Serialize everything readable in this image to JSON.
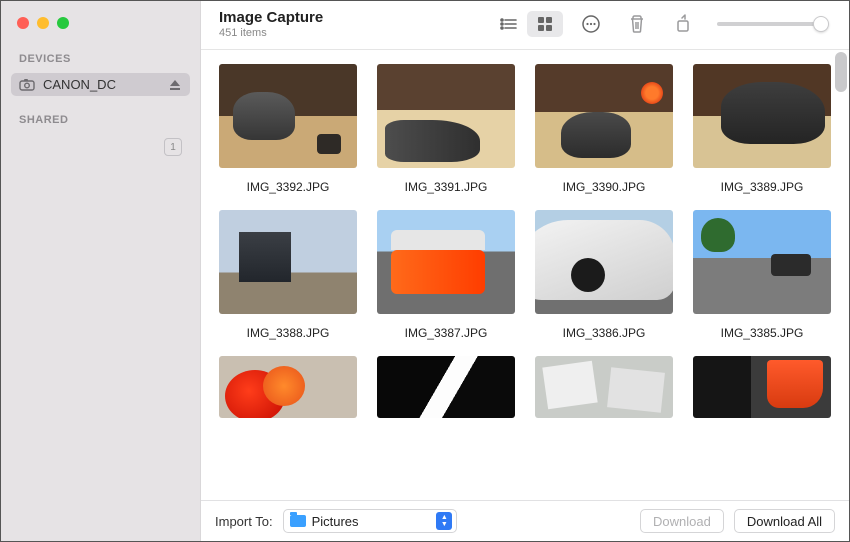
{
  "header": {
    "title": "Image Capture",
    "item_count": "451 items"
  },
  "sidebar": {
    "sections": {
      "devices": "DEVICES",
      "shared": "SHARED"
    },
    "device_name": "CANON_DC",
    "shared_badge": "1"
  },
  "grid": {
    "items": [
      {
        "name": "IMG_3392.JPG"
      },
      {
        "name": "IMG_3391.JPG"
      },
      {
        "name": "IMG_3390.JPG"
      },
      {
        "name": "IMG_3389.JPG"
      },
      {
        "name": "IMG_3388.JPG"
      },
      {
        "name": "IMG_3387.JPG"
      },
      {
        "name": "IMG_3386.JPG"
      },
      {
        "name": "IMG_3385.JPG"
      }
    ]
  },
  "bottombar": {
    "import_label": "Import To:",
    "destination": "Pictures",
    "download": "Download",
    "download_all": "Download All"
  }
}
